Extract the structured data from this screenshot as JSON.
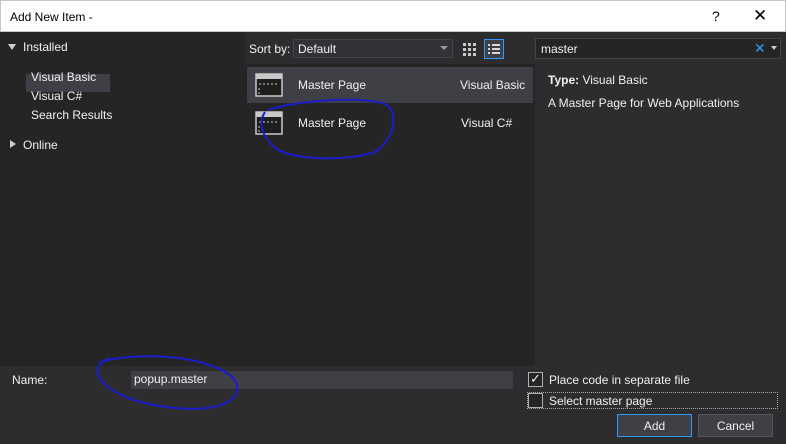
{
  "window": {
    "title": "Add New Item -",
    "help_glyph": "?",
    "close_glyph": "✕"
  },
  "tree": {
    "installed": "Installed",
    "items": [
      "Visual Basic",
      "Visual C#",
      "Search Results"
    ],
    "selected_index": 2,
    "online": "Online"
  },
  "sortbar": {
    "label": "Sort by:",
    "value": "Default"
  },
  "templates": [
    {
      "name": "Master Page",
      "language": "Visual Basic",
      "selected": true
    },
    {
      "name": "Master Page",
      "language": "Visual C#",
      "selected": false
    }
  ],
  "search": {
    "value": "master",
    "clear_glyph": "✕"
  },
  "details": {
    "type_label": "Type:",
    "type_value": "Visual Basic",
    "description": "A Master Page for Web Applications"
  },
  "form": {
    "name_label": "Name:",
    "name_value": "popup.master",
    "place_code_label": "Place code in separate file",
    "place_code_checked": true,
    "select_master_label": "Select master page",
    "select_master_checked": false
  },
  "buttons": {
    "add": "Add",
    "cancel": "Cancel"
  },
  "colors": {
    "accent": "#3399ff",
    "background": "#2d2d30",
    "panel": "#252526",
    "selection": "#3f3f46",
    "annotation_ink": "#1c1ccc"
  },
  "icons": [
    "tile-view-icon",
    "list-view-icon",
    "master-page-icon",
    "search-clear-icon",
    "dropdown-arrow-icon"
  ]
}
